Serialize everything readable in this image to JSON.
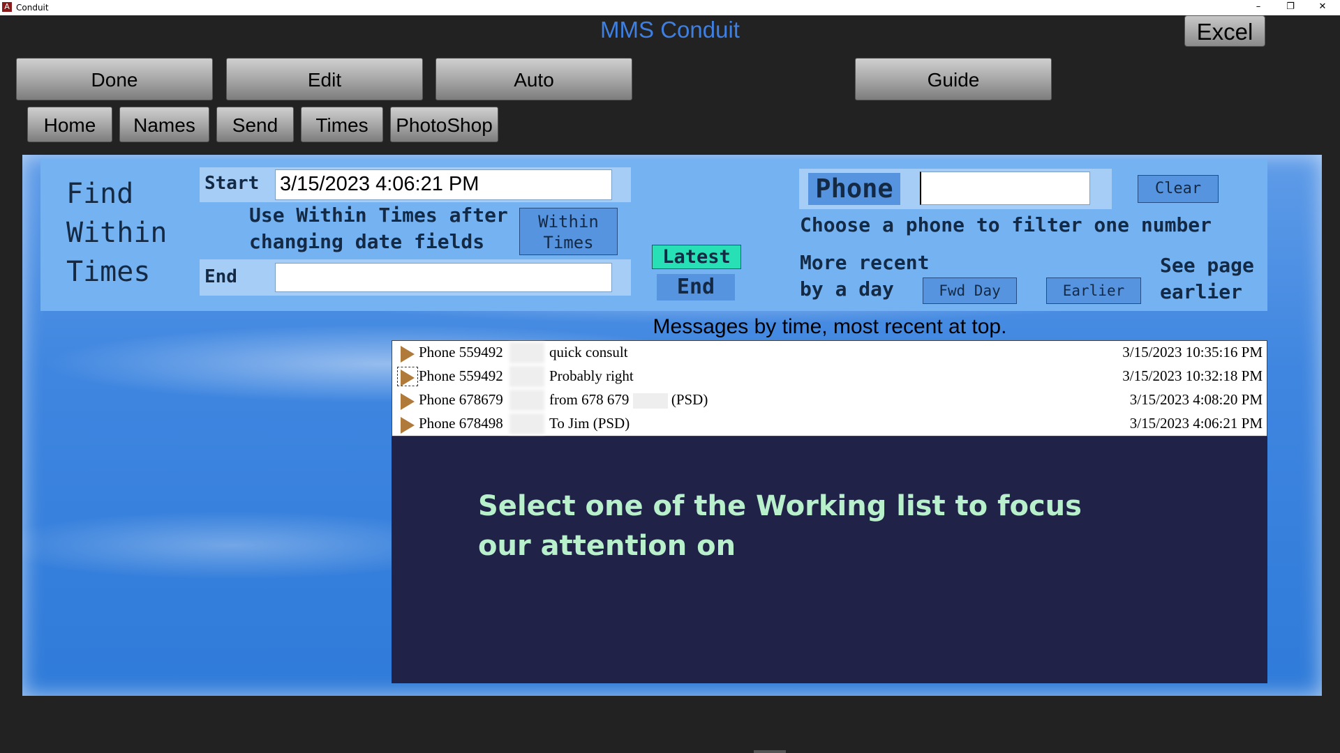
{
  "window": {
    "title": "Conduit",
    "app_icon_glyph": "A",
    "minimize": "–",
    "restore": "❐",
    "close": "✕"
  },
  "app_title": "MMS Conduit",
  "toolbar": {
    "excel": "Excel",
    "done": "Done",
    "edit": "Edit",
    "auto": "Auto",
    "guide": "Guide"
  },
  "nav": {
    "home": "Home",
    "names": "Names",
    "send": "Send",
    "times": "Times",
    "photoshop": "PhotoShop"
  },
  "find": {
    "title_line1": "Find",
    "title_line2": "Within",
    "title_line3": "Times",
    "start_label": "Start",
    "start_value": "3/15/2023 4:06:21 PM",
    "end_label": "End",
    "end_value": "",
    "hint_line1": "Use Within Times after",
    "hint_line2": "changing date fields",
    "within_times_line1": "Within",
    "within_times_line2": "Times",
    "latest": "Latest",
    "end_button": "End"
  },
  "phone_filter": {
    "label": "Phone",
    "value": "",
    "clear": "Clear",
    "hint": "Choose a phone to filter one number",
    "more_recent_line1": "More recent",
    "more_recent_line2": "by a day",
    "fwd_day": "Fwd Day",
    "earlier": "Earlier",
    "see_page_line1": "See page",
    "see_page_line2": "earlier"
  },
  "messages": {
    "title": "Messages by time, most recent at top.",
    "rows": [
      {
        "phone": "Phone 559492",
        "text": "quick consult",
        "text_after": "",
        "time": "3/15/2023 10:35:16 PM"
      },
      {
        "phone": "Phone 559492",
        "text": "Probably right",
        "text_after": "",
        "time": "3/15/2023 10:32:18 PM"
      },
      {
        "phone": "Phone 678679",
        "text": "from 678 679",
        "text_after": "(PSD)",
        "time": "3/15/2023 4:08:20 PM"
      },
      {
        "phone": "Phone 678498",
        "text": "To Jim (PSD)",
        "text_after": "",
        "time": "3/15/2023 4:06:21 PM"
      }
    ]
  },
  "detail": {
    "message": "Select one of the Working list to focus our attention on"
  },
  "colors": {
    "app_title": "#3f7fe0",
    "panel": "#75b2f1",
    "latest": "#27e0b6",
    "detail_bg": "#202248",
    "detail_text": "#b8f0cc"
  }
}
